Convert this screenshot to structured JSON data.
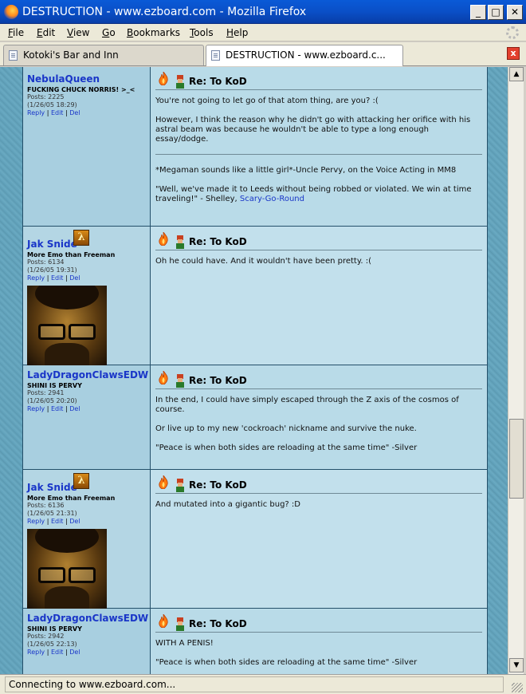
{
  "window": {
    "title": "DESTRUCTION - www.ezboard.com - Mozilla Firefox",
    "minimize": "_",
    "maximize": "□",
    "close": "✕"
  },
  "menu": [
    {
      "label": "File",
      "accel": "F",
      "rest": "ile"
    },
    {
      "label": "Edit",
      "accel": "E",
      "rest": "dit"
    },
    {
      "label": "View",
      "accel": "V",
      "rest": "iew"
    },
    {
      "label": "Go",
      "accel": "G",
      "rest": "o"
    },
    {
      "label": "Bookmarks",
      "accel": "B",
      "rest": "ookmarks"
    },
    {
      "label": "Tools",
      "accel": "T",
      "rest": "ools"
    },
    {
      "label": "Help",
      "accel": "H",
      "rest": "elp"
    }
  ],
  "tabs": [
    {
      "label": "Kotoki's Bar and Inn",
      "active": false
    },
    {
      "label": "DESTRUCTION - www.ezboard.c...",
      "active": true
    }
  ],
  "tab_close": "x",
  "posts": [
    {
      "user": "NebulaQueen",
      "title": "FUCKING CHUCK NORRIS! >_<",
      "posts": "Posts: 2225",
      "date": "(1/26/05 18:29)",
      "subject": "Re: To KoD",
      "messages": [
        "You're not going to let go of that atom thing, are you? :(",
        "However, I think the reason why he didn't go with attacking her orifice with his astral beam was because he wouldn't be able to type a long enough essay/dodge."
      ],
      "signature": [
        "*Megaman sounds like a little girl*-Uncle Pervy, on the Voice Acting in MM8",
        "\"Well, we've made it to Leeds without being robbed or violated. We win at time traveling!\" - Shelley, "
      ],
      "sig_link": "Scary-Go-Round"
    },
    {
      "user": "Jak Snide",
      "title": "More Emo than Freeman",
      "posts": "Posts: 6134",
      "date": "(1/26/05 19:31)",
      "subject": "Re: To KoD",
      "messages": [
        "Oh he could have. And it wouldn't have been pretty. :("
      ]
    },
    {
      "user": "LadyDragonClawsEDW",
      "title": "SHINI IS PERVY",
      "posts": "Posts: 2941",
      "date": "(1/26/05 20:20)",
      "subject": "Re: To KoD",
      "messages": [
        "In the end, I could have simply escaped through the Z axis of the cosmos of course.",
        "Or live up to my new 'cockroach' nickname and survive the nuke.",
        "\"Peace is when both sides are reloading at the same time\" -Silver"
      ]
    },
    {
      "user": "Jak Snide",
      "title": "More Emo than Freeman",
      "posts": "Posts: 6136",
      "date": "(1/26/05 21:31)",
      "subject": "Re: To KoD",
      "messages": [
        "And mutated into a gigantic bug? :D"
      ]
    },
    {
      "user": "LadyDragonClawsEDW",
      "title": "SHINI IS PERVY",
      "posts": "Posts: 2942",
      "date": "(1/26/05 22:13)",
      "subject": "Re: To KoD",
      "messages": [
        "WITH A PENIS!",
        "\"Peace is when both sides are reloading at the same time\" -Silver"
      ]
    }
  ],
  "post_links": {
    "reply": "Reply",
    "edit": "Edit",
    "del": "Del",
    "sep": "|"
  },
  "badge_glyph": "λ",
  "scroll": {
    "up": "▲",
    "down": "▼"
  },
  "status": "Connecting to www.ezboard.com...",
  "colors": {
    "username": "#1a36c8",
    "titlebar": "#0a5ad7",
    "post_bg": "#b9dbe8"
  }
}
